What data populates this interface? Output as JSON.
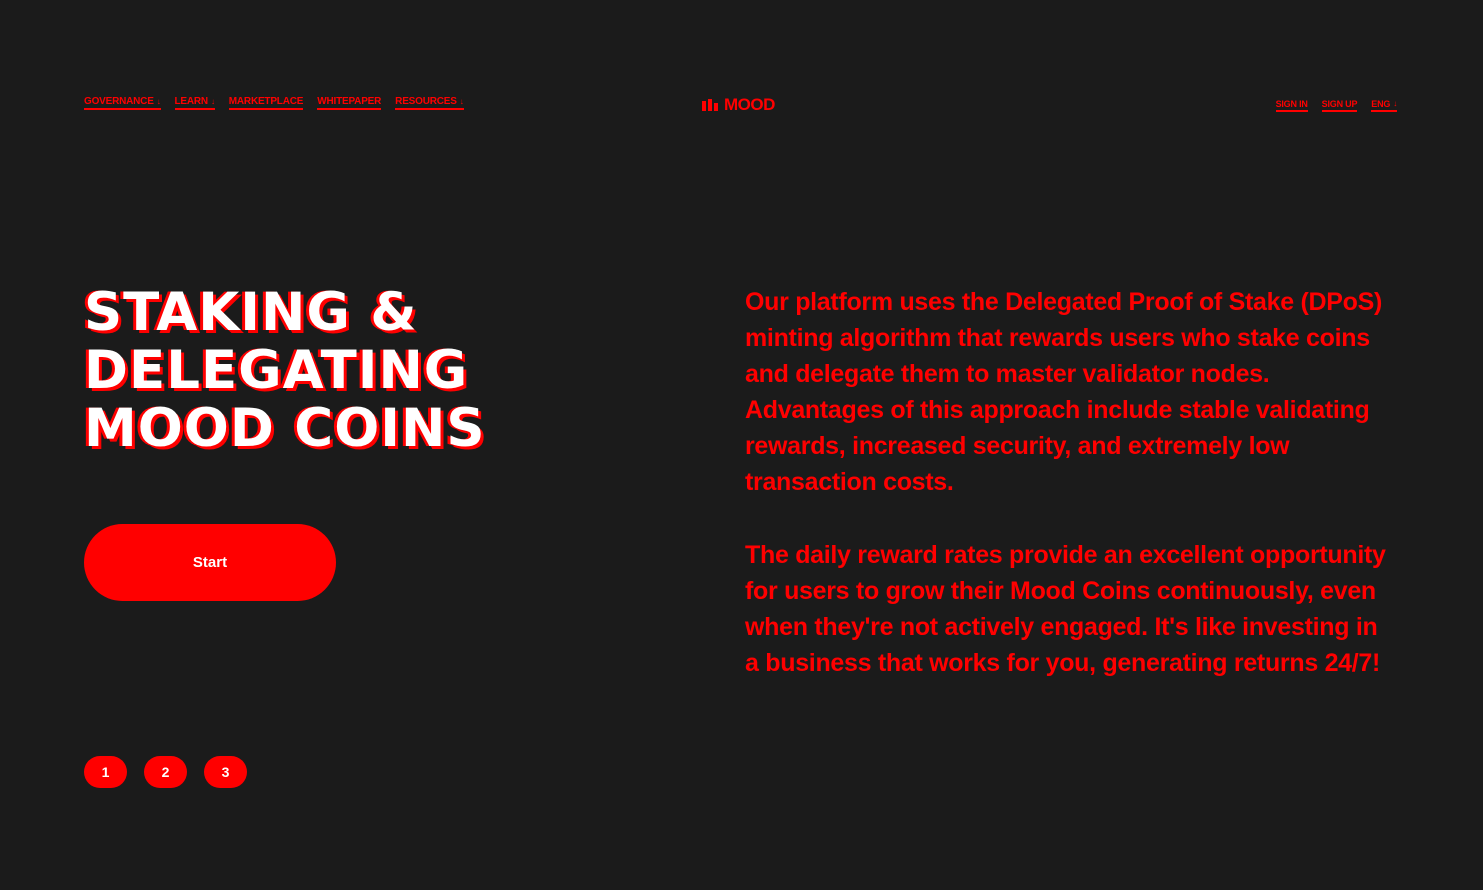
{
  "colors": {
    "background": "#1b1b1b",
    "accent": "#ff0000",
    "headline_fill": "#ffffff"
  },
  "nav": {
    "left": [
      {
        "label": "GOVERNANCE",
        "has_caret": true
      },
      {
        "label": "LEARN",
        "has_caret": true
      },
      {
        "label": "MARKETPLACE",
        "has_caret": false
      },
      {
        "label": "WHITEPAPER",
        "has_caret": false
      },
      {
        "label": "RESOURCES",
        "has_caret": true
      }
    ],
    "logo_text": "MOOD",
    "right": [
      {
        "label": "SIGN IN",
        "has_caret": false
      },
      {
        "label": "SIGN UP",
        "has_caret": false
      },
      {
        "label": "ENG",
        "has_caret": true
      }
    ]
  },
  "hero": {
    "headline_lines": [
      "STAKING &",
      "DELEGATING",
      "MOOD COINS"
    ],
    "cta_label": "Start",
    "steps": [
      "1",
      "2",
      "3"
    ],
    "paragraphs": [
      "Our platform uses the Delegated Proof of Stake (DPoS) minting algorithm that rewards users who stake coins and delegate them to master validator nodes. Advantages of this approach include stable validating rewards, increased security, and extremely low transaction costs.",
      "The daily reward rates provide an excellent opportunity for users to grow their Mood Coins continuously, even when they're not actively engaged. It's like investing in a business that works for you, generating returns 24/7!"
    ]
  }
}
